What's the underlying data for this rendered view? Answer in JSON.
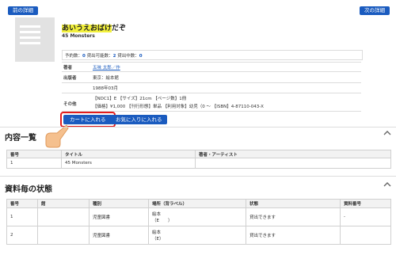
{
  "nav": {
    "prev": "前の詳細",
    "next": "次の詳細"
  },
  "book": {
    "title_highlight": "あいうえおばけ",
    "title_rest": "だぞ",
    "subtitle": "45 Monsters",
    "counts": {
      "reserve_label": "予約数：",
      "reserve": "0",
      "available_label": "貸出可能数：",
      "available": "2",
      "loaned_label": "貸出中数：",
      "loaned": "0"
    },
    "fields": [
      {
        "label": "著者",
        "value": "五味 太郎／作"
      },
      {
        "label": "出版者",
        "value": "東京：絵本館"
      },
      {
        "label": "",
        "value": "1988年03月"
      }
    ],
    "other_label": "その他",
    "other_line1": "【NDC1】E 【サイズ】21cm 【ページ数】1冊",
    "other_line2": "【価格】¥1,000 【刊行形態】単品 【利用対象】幼児（0 ～ 【ISBN】4-87110-043-X"
  },
  "actions": {
    "cart": "カートに入れる",
    "favorite": "お気に入りに入れる"
  },
  "contents": {
    "heading": "内容一覧",
    "headers": [
      "番号",
      "タイトル",
      "著者・アーティスト"
    ],
    "rows": [
      [
        "1",
        "45 Monsters",
        ""
      ]
    ]
  },
  "stock": {
    "heading": "資料毎の状態",
    "headers": [
      "番号",
      "館",
      "種別",
      "場所（背ラベル）",
      "状態",
      "資料番号"
    ],
    "rows": [
      {
        "no": "1",
        "lib": "",
        "type": "児童図書",
        "loc1": "絵本",
        "loc2": "（E　　）",
        "status": "貸出できます",
        "id": "-"
      },
      {
        "no": "2",
        "lib": "",
        "type": "児童図書",
        "loc1": "絵本",
        "loc2": "（E）",
        "status": "貸出できます",
        "id": ""
      }
    ]
  },
  "icons": {
    "section_toggle": "chevron-up-icon",
    "pointer": "pointing-hand-icon"
  },
  "colors": {
    "accent": "#1a5bbf",
    "highlight": "#f2f03c",
    "callout": "#e21d1d"
  }
}
